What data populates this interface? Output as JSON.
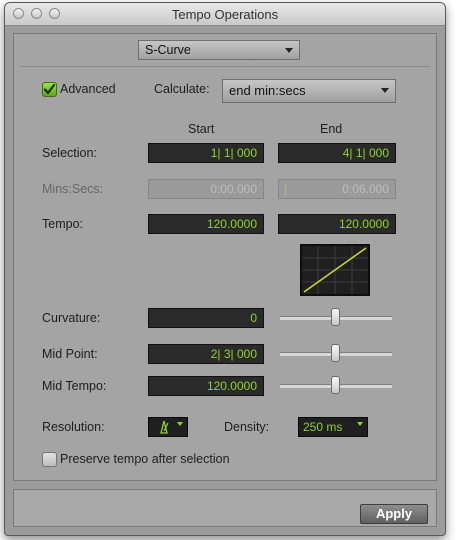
{
  "window": {
    "title": "Tempo Operations"
  },
  "operation": {
    "selected": "S-Curve"
  },
  "advanced": {
    "label": "Advanced",
    "checked": true
  },
  "calculate": {
    "label": "Calculate:",
    "selected": "end min:secs"
  },
  "columns": {
    "start": "Start",
    "end": "End"
  },
  "rows": {
    "selection": {
      "label": "Selection:",
      "start": "1| 1| 000",
      "end": "4| 1| 000"
    },
    "mins_secs": {
      "label": "Mins:Secs:",
      "start": "0:00.000",
      "end": "0:06.000"
    },
    "tempo": {
      "label": "Tempo:",
      "start": "120.0000",
      "end": "120.0000"
    }
  },
  "curvature": {
    "label": "Curvature:",
    "value": "0"
  },
  "mid_point": {
    "label": "Mid Point:",
    "value": "2| 3| 000"
  },
  "mid_tempo": {
    "label": "Mid Tempo:",
    "value": "120.0000"
  },
  "resolution": {
    "label": "Resolution:"
  },
  "density": {
    "label": "Density:",
    "value": "250 ms"
  },
  "preserve": {
    "label": "Preserve tempo after selection",
    "checked": false
  },
  "apply": {
    "label": "Apply"
  },
  "colors": {
    "accent": "#8fd61f",
    "field_bg": "#2a2a2a",
    "window_bg": "#a4a4a4"
  }
}
